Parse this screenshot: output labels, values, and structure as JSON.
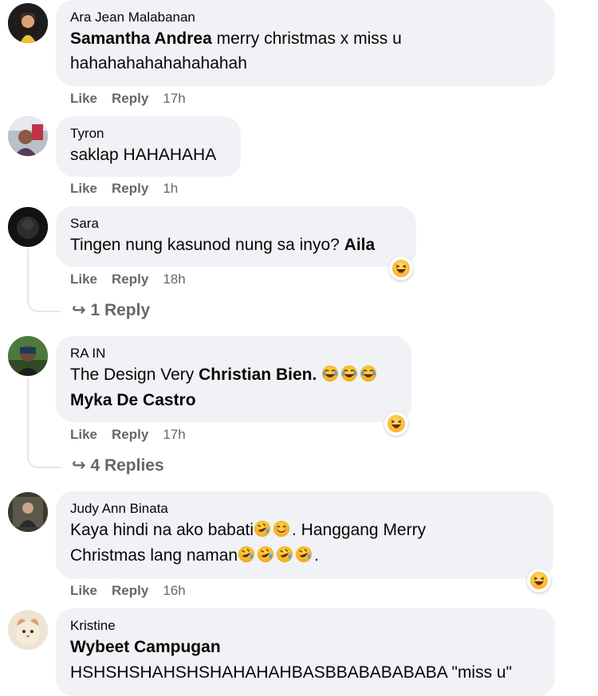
{
  "actions": {
    "like": "Like",
    "reply": "Reply"
  },
  "comments": [
    {
      "author": "Ara Jean Malabanan",
      "mention": "Samantha Andrea",
      "text_line1": "merry christmas x miss u",
      "text_line2": "hahahahahahahahahah",
      "time": "17h"
    },
    {
      "author": "Tyron",
      "text": "saklap HAHAHAHA",
      "time": "1h"
    },
    {
      "author": "Sara",
      "text": "Tingen nung kasunod nung sa inyo?",
      "mention": "Aila",
      "time": "18h",
      "replies": "1 Reply",
      "reaction": "haha-icon"
    },
    {
      "author": "RA IN",
      "text": "The Design Very",
      "mention1": "Christian Bien.",
      "mention2": "Myka De Castro",
      "time": "17h",
      "replies": "4 Replies",
      "reaction": "haha-icon"
    },
    {
      "author": "Judy Ann Binata",
      "text_line1a": "Kaya hindi na ako babati",
      "text_line1b": ". Hanggang Merry",
      "text_line2a": "Christmas lang naman",
      "text_line2b": ".",
      "time": "16h",
      "reaction": "haha-icon"
    },
    {
      "author": "Kristine",
      "mention": "Wybeet Campugan",
      "text": "HSHSHSHAHSHSHAHAHAHBASBBABABABABA \"miss u\""
    }
  ]
}
